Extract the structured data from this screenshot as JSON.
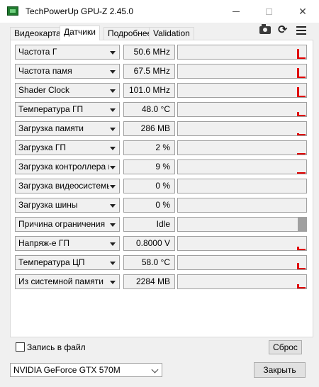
{
  "window": {
    "title": "TechPowerUp GPU-Z 2.45.0"
  },
  "tabs": [
    {
      "label": "Видеокарта",
      "active": false
    },
    {
      "label": "Датчики",
      "active": true
    },
    {
      "label": "Подробнее",
      "active": false
    },
    {
      "label": "Validation",
      "active": false
    }
  ],
  "toolbar": {
    "icons": [
      "camera-icon",
      "refresh-icon",
      "menu-icon"
    ]
  },
  "sensors": [
    {
      "label": "Частота Г",
      "value": "50.6 MHz"
    },
    {
      "label": "Частота памя",
      "value": "67.5 MHz"
    },
    {
      "label": "Shader Clock",
      "value": "101.0 MHz"
    },
    {
      "label": "Температура ГП",
      "value": "48.0 °C"
    },
    {
      "label": "Загрузка памяти",
      "value": "286 MB"
    },
    {
      "label": "Загрузка ГП",
      "value": "2 %"
    },
    {
      "label": "Загрузка контроллера па.",
      "value": "9 %"
    },
    {
      "label": "Загрузка видеосистемы",
      "value": "0 %"
    },
    {
      "label": "Загрузка шины",
      "value": "0 %"
    },
    {
      "label": "Причина ограничения",
      "value": "Idle"
    },
    {
      "label": "Напряж-е ГП",
      "value": "0.8000 V"
    },
    {
      "label": "Температура ЦП",
      "value": "58.0 °C"
    },
    {
      "label": "Из системной памяти",
      "value": "2284 MB"
    }
  ],
  "graph_levels": [
    0.75,
    0.75,
    0.75,
    0.3,
    0.15,
    0.08,
    0.12,
    0.0,
    0.0,
    1.0,
    0.25,
    0.45,
    0.3
  ],
  "footer": {
    "log_checkbox_label": "Запись в файл",
    "log_checked": false,
    "reset_button": "Сброс",
    "gpu_selected": "NVIDIA GeForce GTX 570M",
    "close_button": "Закрыть"
  },
  "colors": {
    "graph": "#e00000",
    "limit_bar": "#a0a0a0"
  }
}
